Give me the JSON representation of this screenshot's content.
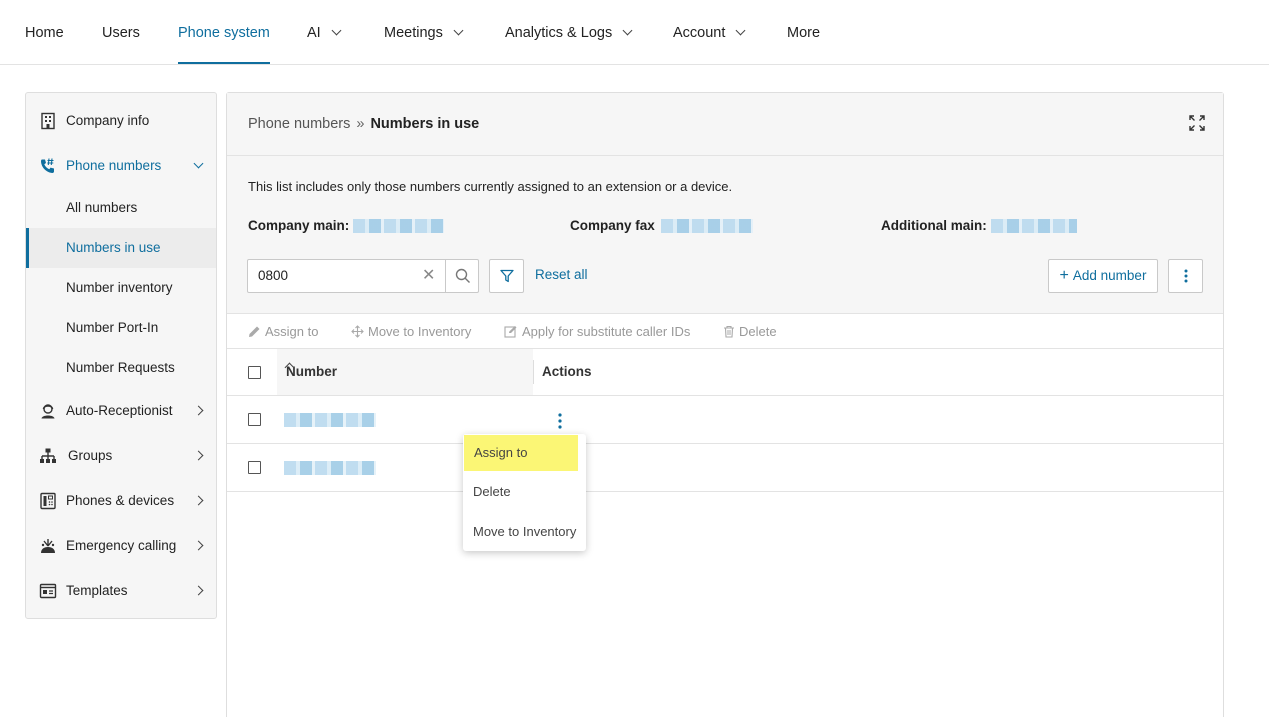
{
  "topnav": {
    "items": [
      {
        "label": "Home"
      },
      {
        "label": "Users"
      },
      {
        "label": "Phone system"
      },
      {
        "label": "AI"
      },
      {
        "label": "Meetings"
      },
      {
        "label": "Analytics & Logs"
      },
      {
        "label": "Account"
      },
      {
        "label": "More"
      }
    ],
    "active": "Phone system"
  },
  "sidebar": {
    "items": [
      {
        "label": "Company info",
        "icon": "building-icon"
      },
      {
        "label": "Phone numbers",
        "icon": "phone-hash-icon",
        "expanded": true
      },
      {
        "label": "Auto-Receptionist",
        "icon": "receptionist-icon"
      },
      {
        "label": "Groups",
        "icon": "org-chart-icon"
      },
      {
        "label": "Phones & devices",
        "icon": "desk-phone-icon"
      },
      {
        "label": "Emergency calling",
        "icon": "emergency-icon"
      },
      {
        "label": "Templates",
        "icon": "template-icon"
      }
    ],
    "subitems": [
      {
        "label": "All numbers"
      },
      {
        "label": "Numbers in use"
      },
      {
        "label": "Number inventory"
      },
      {
        "label": "Number Port-In"
      },
      {
        "label": "Number Requests"
      }
    ],
    "active_subitem": "Numbers in use"
  },
  "breadcrumb": {
    "parent": "Phone numbers",
    "separator": "»",
    "current": "Numbers in use"
  },
  "info": {
    "text": "This list includes only those numbers currently assigned to an extension or a device.",
    "company_main_label": "Company main:",
    "company_fax_label": "Company fax",
    "additional_main_label": "Additional main:"
  },
  "search": {
    "value": "0800",
    "clear_glyph": "✕"
  },
  "filters": {
    "reset_label": "Reset all"
  },
  "actions": {
    "add_number_label": "Add number",
    "add_glyph": "+"
  },
  "toolbar": {
    "assign_to": "Assign to",
    "move_to_inventory": "Move to Inventory",
    "apply_substitute": "Apply for substitute caller IDs",
    "delete": "Delete"
  },
  "table": {
    "columns": [
      "Number",
      "Actions"
    ],
    "rows": [
      {
        "number_redacted": true
      },
      {
        "number_redacted": true
      }
    ]
  },
  "context_menu": {
    "items": [
      {
        "label": "Assign to",
        "highlighted": true
      },
      {
        "label": "Delete"
      },
      {
        "label": "Move to Inventory"
      }
    ]
  },
  "colors": {
    "accent": "#0f6e9e",
    "highlight": "#fbf675",
    "panel_bg": "#f6f6f6"
  }
}
